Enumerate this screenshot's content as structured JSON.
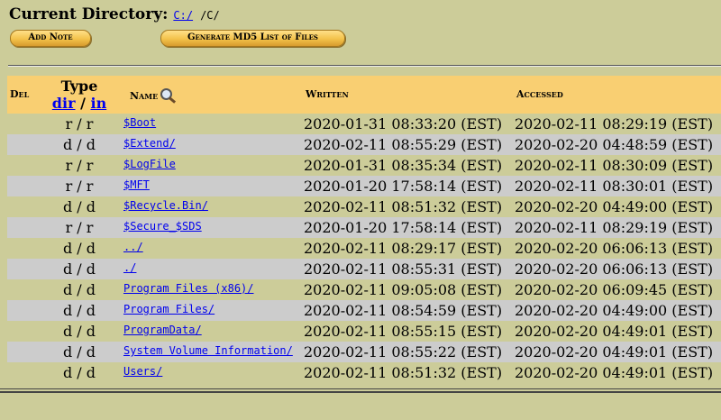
{
  "header": {
    "title": "Current Directory:",
    "path_link": "C:/",
    "path_tail": "/C/"
  },
  "buttons": {
    "add_note": "Add Note",
    "generate_md5": "Generate MD5 List of Files"
  },
  "table": {
    "headers": {
      "del": "Del",
      "type": "Type",
      "type_dir": "dir",
      "type_sep": " / ",
      "type_in": "in",
      "name": "Name",
      "written": "Written",
      "accessed": "Accessed"
    },
    "rows": [
      {
        "type": "r / r",
        "name": "$Boot",
        "written": "2020-01-31 08:33:20 (EST)",
        "accessed": "2020-02-11 08:29:19 (EST)"
      },
      {
        "type": "d / d",
        "name": "$Extend/",
        "written": "2020-02-11 08:55:29 (EST)",
        "accessed": "2020-02-20 04:48:59 (EST)"
      },
      {
        "type": "r / r",
        "name": "$LogFile",
        "written": "2020-01-31 08:35:34 (EST)",
        "accessed": "2020-02-11 08:30:09 (EST)"
      },
      {
        "type": "r / r",
        "name": "$MFT",
        "written": "2020-01-20 17:58:14 (EST)",
        "accessed": "2020-02-11 08:30:01 (EST)"
      },
      {
        "type": "d / d",
        "name": "$Recycle.Bin/",
        "written": "2020-02-11 08:51:32 (EST)",
        "accessed": "2020-02-20 04:49:00 (EST)"
      },
      {
        "type": "r / r",
        "name": "$Secure_$SDS",
        "written": "2020-01-20 17:58:14 (EST)",
        "accessed": "2020-02-11 08:29:19 (EST)"
      },
      {
        "type": "d / d",
        "name": "../",
        "written": "2020-02-11 08:29:17 (EST)",
        "accessed": "2020-02-20 06:06:13 (EST)"
      },
      {
        "type": "d / d",
        "name": "./",
        "written": "2020-02-11 08:55:31 (EST)",
        "accessed": "2020-02-20 06:06:13 (EST)"
      },
      {
        "type": "d / d",
        "name": "Program Files (x86)/",
        "written": "2020-02-11 09:05:08 (EST)",
        "accessed": "2020-02-20 06:09:45 (EST)"
      },
      {
        "type": "d / d",
        "name": "Program Files/",
        "written": "2020-02-11 08:54:59 (EST)",
        "accessed": "2020-02-20 04:49:00 (EST)"
      },
      {
        "type": "d / d",
        "name": "ProgramData/",
        "written": "2020-02-11 08:55:15 (EST)",
        "accessed": "2020-02-20 04:49:01 (EST)"
      },
      {
        "type": "d / d",
        "name": "System Volume Information/",
        "written": "2020-02-11 08:55:22 (EST)",
        "accessed": "2020-02-20 04:49:01 (EST)"
      },
      {
        "type": "d / d",
        "name": "Users/",
        "written": "2020-02-11 08:51:32 (EST)",
        "accessed": "2020-02-20 04:49:01 (EST)"
      }
    ]
  },
  "icons": {
    "name_sort": "magnifier-icon"
  },
  "colors": {
    "background": "#CCCC99",
    "header_row": "#F9CF72",
    "alt_row": "#CCCCCC",
    "link": "#0000EE",
    "button": "#F3C24A"
  }
}
